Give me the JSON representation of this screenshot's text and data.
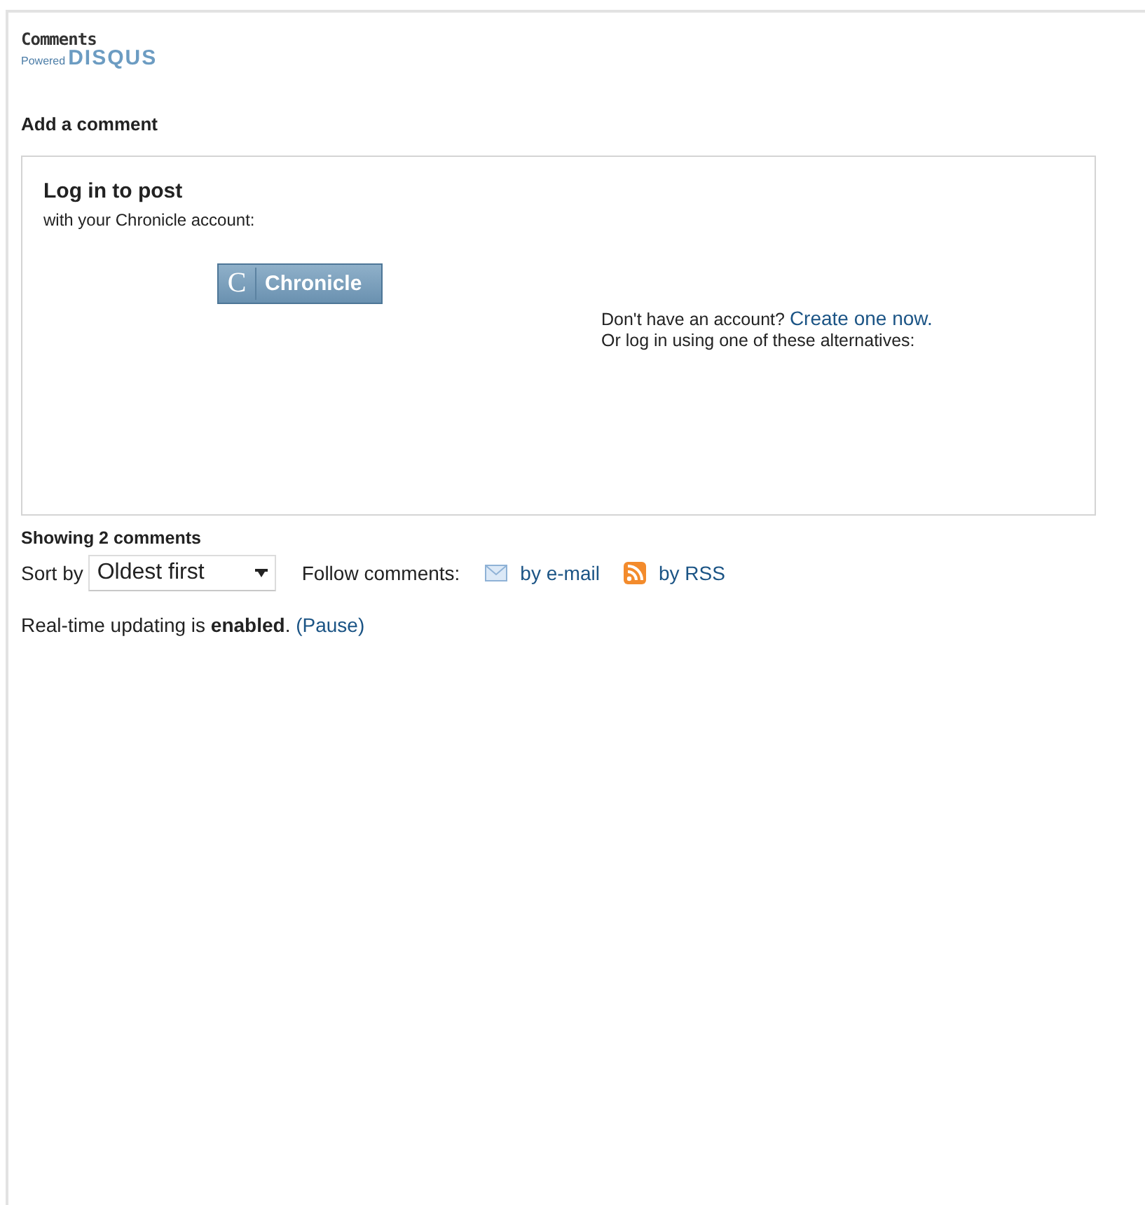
{
  "header": {
    "title": "Comments",
    "powered": "Powered",
    "brand": "DISQUS"
  },
  "add_comment": {
    "heading": "Add a comment"
  },
  "login": {
    "title": "Log in to post",
    "subtitle": "with your Chronicle account:",
    "provider_letter": "C",
    "provider_label": "Chronicle",
    "no_account": "Don't have an account?",
    "create_link": "Create one now.",
    "alternatives": "Or log in using one of these alternatives:"
  },
  "comments": {
    "count_label": "Showing 2 comments",
    "sort_label": "Sort by",
    "sort_value": "Oldest first",
    "follow_label": "Follow comments:",
    "email_link": "by e-mail",
    "rss_link": "by RSS"
  },
  "realtime": {
    "text": "Real-time updating is **enabled**.",
    "pause_link": "(Pause)"
  }
}
